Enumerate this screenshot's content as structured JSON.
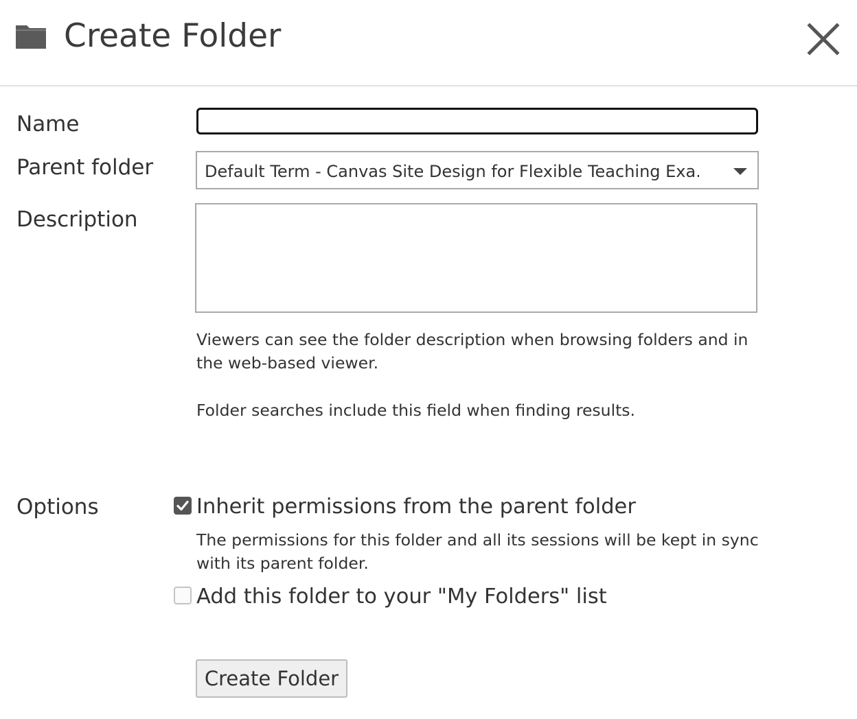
{
  "dialog": {
    "title": "Create Folder",
    "icons": {
      "header": "folder-icon",
      "close": "close-icon"
    }
  },
  "form": {
    "name": {
      "label": "Name",
      "value": ""
    },
    "parent_folder": {
      "label": "Parent folder",
      "selected": "Default Term - Canvas Site Design for Flexible Teaching Exa..."
    },
    "description": {
      "label": "Description",
      "value": "",
      "help_1": "Viewers can see the folder description when browsing folders and in the web-based viewer.",
      "help_2": "Folder searches include this field when finding results."
    },
    "options": {
      "label": "Options",
      "inherit": {
        "label": "Inherit permissions from the parent folder",
        "checked": true,
        "help": "The permissions for this folder and all its sessions will be kept in sync with its parent folder."
      },
      "my_folders": {
        "label": "Add this folder to your \"My Folders\" list",
        "checked": false
      }
    },
    "submit_label": "Create Folder"
  },
  "colors": {
    "text": "#333333",
    "icon": "#555555",
    "divider": "#e1e1e1",
    "focus_border": "#111111"
  }
}
